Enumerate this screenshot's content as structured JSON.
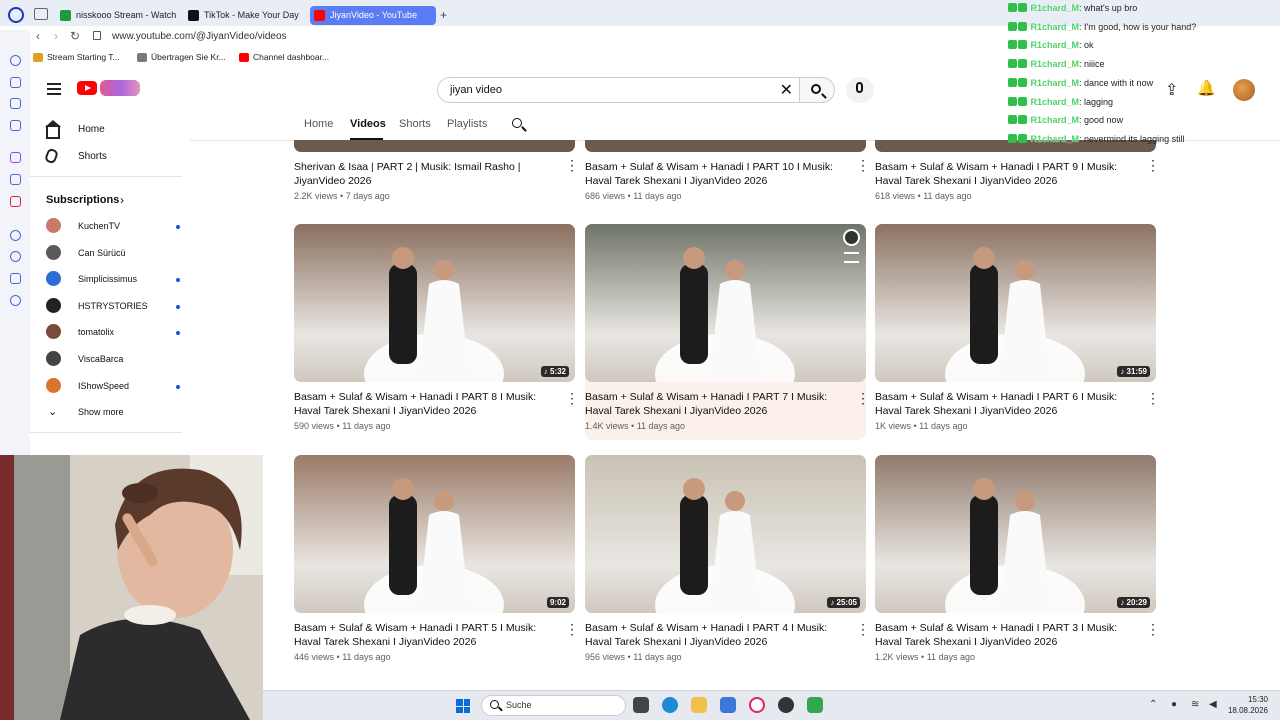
{
  "browser": {
    "tabs": [
      {
        "label": "nisskooo Stream - Watch L",
        "color": "#1a9c3a"
      },
      {
        "label": "TikTok - Make Your Day",
        "color": "#111111"
      },
      {
        "label": "JiyanVideo - YouTube",
        "color": "#ff0000"
      }
    ],
    "url": "www.youtube.com/@JiyanVideo/videos",
    "bookmarks": [
      {
        "label": "Stream Starting T...",
        "color": "#e0a020"
      },
      {
        "label": "Übertragen Sie Kr...",
        "color": "#7a7a7a"
      },
      {
        "label": "Channel dashboar...",
        "color": "#ff0000"
      }
    ]
  },
  "youtube": {
    "search_value": "jiyan video",
    "nav": {
      "home": "Home",
      "shorts": "Shorts"
    },
    "subscriptions_title": "Subscriptions",
    "subscriptions": [
      {
        "name": "KuchenTV",
        "color": "#c97a6a",
        "dot": true
      },
      {
        "name": "Can Sürücü",
        "color": "#5a5a5a",
        "dot": false
      },
      {
        "name": "Simplicissimus",
        "color": "#2b6fd6",
        "dot": true
      },
      {
        "name": "HSTRYSTORIES",
        "color": "#222222",
        "dot": true
      },
      {
        "name": "tomatolix",
        "color": "#7a4a3a",
        "dot": true
      },
      {
        "name": "ViscaBarca",
        "color": "#444444",
        "dot": false
      },
      {
        "name": "IShowSpeed",
        "color": "#d9752b",
        "dot": true
      }
    ],
    "show_more": "Show more",
    "channel_tabs": [
      "Home",
      "Videos",
      "Shorts",
      "Playlists"
    ],
    "row_top": [
      {
        "title": "Sherivan & Isaa | PART 2 | Musik: Ismail Rasho | JiyanVideo 2026",
        "views": "2.2K views",
        "age": "7 days ago"
      },
      {
        "title": "Basam + Sulaf & Wisam + Hanadi I PART 10 I Musik: Haval Tarek Shexani I JiyanVideo 2026",
        "views": "686 views",
        "age": "11 days ago"
      },
      {
        "title": "Basam + Sulaf & Wisam + Hanadi I PART 9 I Musik: Haval Tarek Shexani I JiyanVideo 2026",
        "views": "618 views",
        "age": "11 days ago"
      }
    ],
    "videos": [
      {
        "title": "Basam + Sulaf & Wisam + Hanadi I PART 8 I Musik: Haval Tarek Shexani I JiyanVideo 2026",
        "views": "590 views",
        "age": "11 days ago",
        "duration": "♪ 5:32",
        "bg": "#8a6f5e"
      },
      {
        "title": "Basam + Sulaf & Wisam + Hanadi I PART 7 I Musik: Haval Tarek Shexani I JiyanVideo 2026",
        "views": "1.4K views",
        "age": "11 days ago",
        "duration": "",
        "bg": "#6f7468"
      },
      {
        "title": "Basam + Sulaf & Wisam + Hanadi I PART 6 I Musik: Haval Tarek Shexani I JiyanVideo 2026",
        "views": "1K views",
        "age": "11 days ago",
        "duration": "♪ 31:59",
        "bg": "#8b7262"
      },
      {
        "title": "Basam + Sulaf & Wisam + Hanadi I PART 5 I Musik: Haval Tarek Shexani I JiyanVideo 2026",
        "views": "446 views",
        "age": "11 days ago",
        "duration": "9:02",
        "bg": "#9a7b68"
      },
      {
        "title": "Basam + Sulaf & Wisam + Hanadi I PART 4 I Musik: Haval Tarek Shexani I JiyanVideo 2026",
        "views": "956 views",
        "age": "11 days ago",
        "duration": "♪ 25:05",
        "bg": "#c9c2b4"
      },
      {
        "title": "Basam + Sulaf & Wisam + Hanadi I PART 3 I Musik: Haval Tarek Shexani I JiyanVideo 2026",
        "views": "1.2K views",
        "age": "11 days ago",
        "duration": "♪ 20:29",
        "bg": "#8f7a6c"
      }
    ]
  },
  "chat": [
    {
      "user": "R1chard_M",
      "msg": ": what's up bro"
    },
    {
      "user": "R1chard_M",
      "msg": ": I'm good, how is your hand?"
    },
    {
      "user": "R1chard_M",
      "msg": ": ok"
    },
    {
      "user": "R1chard_M",
      "msg": ": niiice"
    },
    {
      "user": "R1chard_M",
      "msg": ": dance with it now"
    },
    {
      "user": "R1chard_M",
      "msg": ": lagging"
    },
    {
      "user": "R1chard_M",
      "msg": ": good now"
    },
    {
      "user": "R1chard_M",
      "msg": ": nevermind its lagging still"
    }
  ],
  "taskbar": {
    "search_placeholder": "Suche",
    "time": "15:30",
    "date": "18.08.2026"
  }
}
